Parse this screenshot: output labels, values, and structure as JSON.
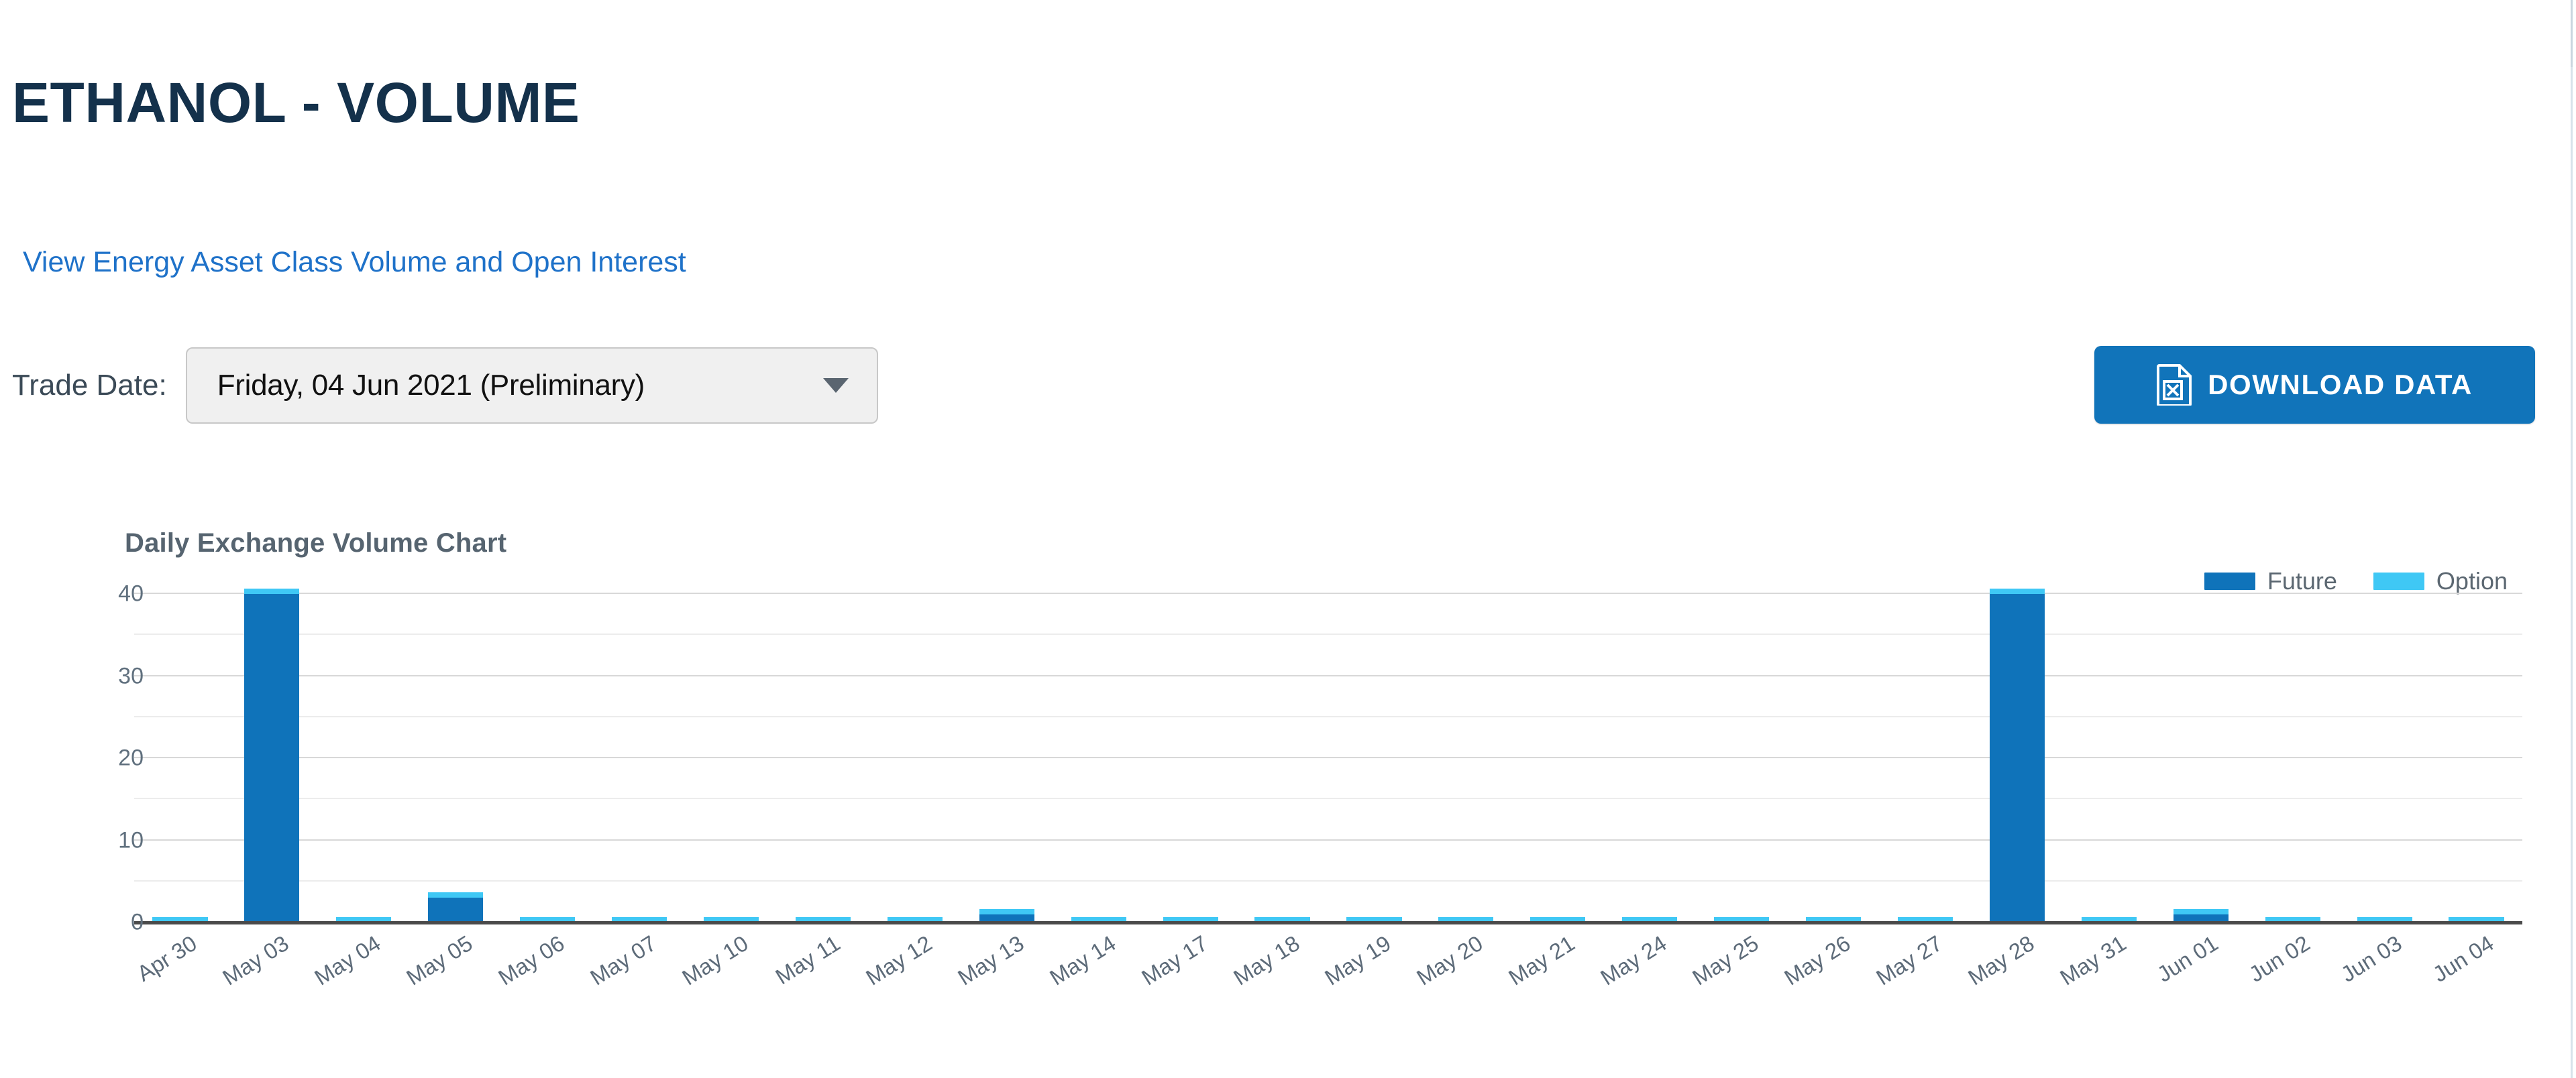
{
  "header": {
    "title": "ETHANOL - VOLUME",
    "asset_class_link": "View Energy Asset Class Volume and Open Interest"
  },
  "controls": {
    "trade_date_label": "Trade Date:",
    "trade_date_value": "Friday, 04 Jun 2021 (Preliminary)",
    "download_label": "DOWNLOAD DATA",
    "download_icon": "excel-file-icon",
    "caret_icon": "chevron-down-icon"
  },
  "colors": {
    "title": "#14314B",
    "link": "#1F72C9",
    "button": "#1174BA",
    "future": "#0F73BA",
    "option": "#3FC8F5",
    "grid": "#D8D8D8",
    "axis": "#4A4A4A"
  },
  "chart_data": {
    "type": "bar",
    "title": "Daily Exchange Volume Chart",
    "xlabel": "",
    "ylabel": "",
    "ylim": [
      0,
      40
    ],
    "yticks": [
      0,
      10,
      20,
      30,
      40
    ],
    "minor_yticks": [
      5,
      15,
      25,
      35
    ],
    "grid": true,
    "stacked": true,
    "legend_position": "top-right",
    "categories": [
      "Apr 30",
      "May 03",
      "May 04",
      "May 05",
      "May 06",
      "May 07",
      "May 10",
      "May 11",
      "May 12",
      "May 13",
      "May 14",
      "May 17",
      "May 18",
      "May 19",
      "May 20",
      "May 21",
      "May 24",
      "May 25",
      "May 26",
      "May 27",
      "May 28",
      "May 31",
      "Jun 01",
      "Jun 02",
      "Jun 03",
      "Jun 04"
    ],
    "series": [
      {
        "name": "Future",
        "color": "#0F73BA",
        "values": [
          0,
          40,
          0,
          3,
          0,
          0,
          0,
          0,
          0,
          1,
          0,
          0,
          0,
          0,
          0,
          0,
          0,
          0,
          0,
          0,
          40,
          0,
          1,
          0,
          0,
          0
        ]
      },
      {
        "name": "Option",
        "color": "#3FC8F5",
        "values": [
          0,
          0,
          0,
          0,
          0,
          0,
          0,
          0,
          0,
          0,
          0,
          0,
          0,
          0,
          0,
          0,
          0,
          0,
          0,
          0,
          0,
          0,
          0,
          0,
          0,
          0
        ]
      }
    ]
  }
}
